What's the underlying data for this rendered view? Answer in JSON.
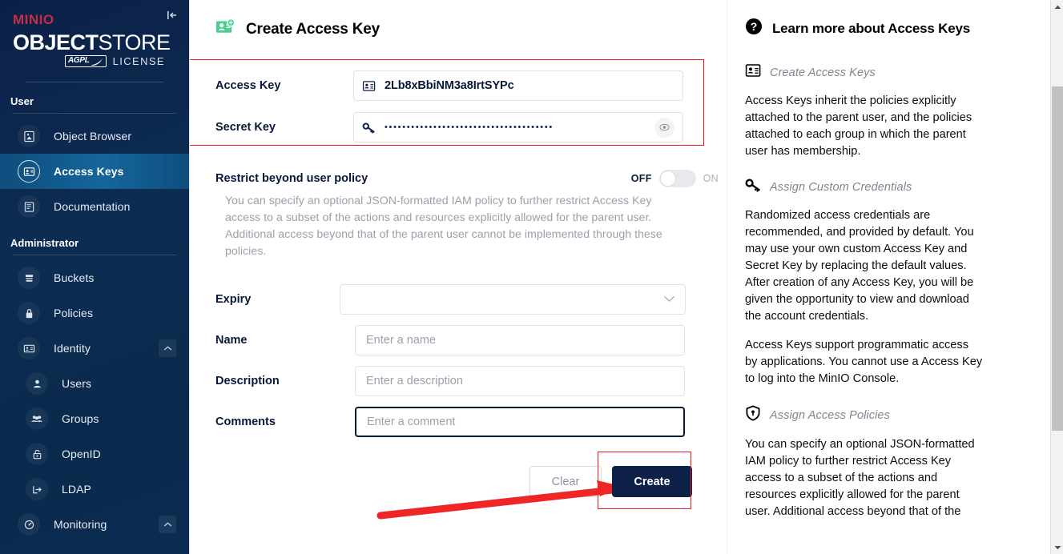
{
  "sidebar": {
    "logo": {
      "minio": "MINIO",
      "object": "OBJECT",
      "store": "STORE",
      "agpl": "AGPL",
      "license": "LICENSE"
    },
    "collapse_icon": "collapse-sidebar-icon",
    "sections": [
      {
        "label": "User",
        "items": [
          {
            "label": "Object Browser",
            "icon": "object-browser-icon",
            "active": false
          },
          {
            "label": "Access Keys",
            "icon": "access-keys-icon",
            "active": true
          },
          {
            "label": "Documentation",
            "icon": "documentation-icon",
            "active": false
          }
        ]
      },
      {
        "label": "Administrator",
        "items": [
          {
            "label": "Buckets",
            "icon": "buckets-icon",
            "active": false
          },
          {
            "label": "Policies",
            "icon": "policies-icon",
            "active": false
          },
          {
            "label": "Identity",
            "icon": "identity-icon",
            "active": false,
            "expandable": true
          },
          {
            "label": "Users",
            "icon": "user-icon",
            "active": false,
            "sub": true
          },
          {
            "label": "Groups",
            "icon": "groups-icon",
            "active": false,
            "sub": true
          },
          {
            "label": "OpenID",
            "icon": "openid-icon",
            "active": false,
            "sub": true
          },
          {
            "label": "LDAP",
            "icon": "ldap-icon",
            "active": false,
            "sub": true
          },
          {
            "label": "Monitoring",
            "icon": "monitoring-icon",
            "active": false,
            "expandable": true
          }
        ]
      }
    ]
  },
  "main": {
    "page_title": "Create Access Key",
    "page_title_icon": "create-access-key-icon",
    "access_key": {
      "label": "Access Key",
      "value": "2Lb8xBbiNM3a8IrtSYPc",
      "icon": "id-card-icon"
    },
    "secret_key": {
      "label": "Secret Key",
      "value": "••••••••••••••••••••••••••••••••••••••",
      "icon": "key-icon",
      "reveal_icon": "eye-icon"
    },
    "restrict": {
      "label": "Restrict beyond user policy",
      "off_label": "OFF",
      "on_label": "ON",
      "state": "OFF",
      "description": "You can specify an optional JSON-formatted IAM policy to further restrict Access Key access to a subset of the actions and resources explicitly allowed for the parent user. Additional access beyond that of the parent user cannot be implemented through these policies."
    },
    "expiry": {
      "label": "Expiry",
      "value": "",
      "caret_icon": "chevron-down-icon"
    },
    "name": {
      "label": "Name",
      "value": "",
      "placeholder": "Enter a name"
    },
    "description": {
      "label": "Description",
      "value": "",
      "placeholder": "Enter a description"
    },
    "comments": {
      "label": "Comments",
      "value": "",
      "placeholder": "Enter a comment"
    },
    "buttons": {
      "clear": "Clear",
      "create": "Create"
    },
    "highlight_color": "#e1231f",
    "accent_color": "#0d2148",
    "title_icon_color": "#4ccf8e"
  },
  "help": {
    "title": "Learn more about Access Keys",
    "title_icon": "question-circle-icon",
    "sections": [
      {
        "heading": "Create Access Keys",
        "icon": "id-card-icon",
        "paragraphs": [
          "Access Keys inherit the policies explicitly attached to the parent user, and the policies attached to each group in which the parent user has membership."
        ]
      },
      {
        "heading": "Assign Custom Credentials",
        "icon": "key-icon",
        "paragraphs": [
          "Randomized access credentials are recommended, and provided by default. You may use your own custom Access Key and Secret Key by replacing the default values. After creation of any Access Key, you will be given the opportunity to view and download the account credentials.",
          "Access Keys support programmatic access by applications. You cannot use a Access Key to log into the MinIO Console."
        ]
      },
      {
        "heading": "Assign Access Policies",
        "icon": "shield-icon",
        "paragraphs": [
          "You can specify an optional JSON-formatted IAM policy to further restrict Access Key access to a subset of the actions and resources explicitly allowed for the parent user. Additional access beyond that of the"
        ]
      }
    ]
  },
  "scrollbar": {
    "up_icon": "scroll-up-arrow-icon",
    "down_icon": "scroll-down-arrow-icon"
  }
}
